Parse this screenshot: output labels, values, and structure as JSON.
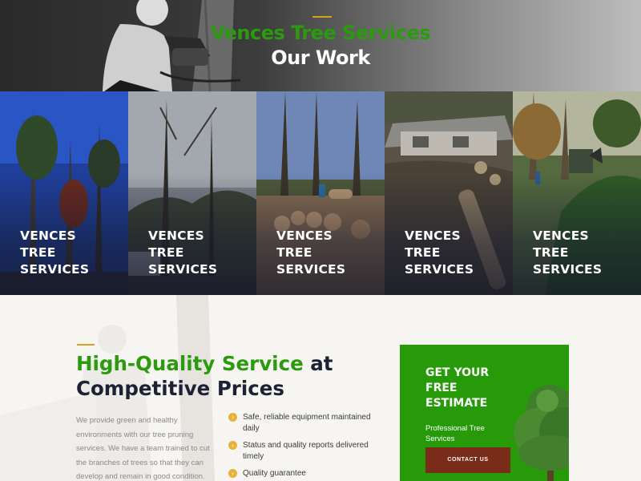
{
  "hero": {
    "brand": "Vences Tree Services",
    "title": "Our Work"
  },
  "gallery": {
    "tiles": [
      {
        "caption_lines": [
          "VENCES",
          "TREE",
          "SERVICES"
        ]
      },
      {
        "caption_lines": [
          "VENCES",
          "TREE",
          "SERVICES"
        ]
      },
      {
        "caption_lines": [
          "VENCES",
          "TREE",
          "SERVICES"
        ]
      },
      {
        "caption_lines": [
          "VENCES",
          "TREE",
          "SERVICES"
        ]
      },
      {
        "caption_lines": [
          "VENCES",
          "TREE",
          "SERVICES"
        ]
      }
    ]
  },
  "quality": {
    "headline_green": "High-Quality Service",
    "headline_rest_1": " at",
    "headline_rest_2": "Competitive Prices",
    "description": "We provide green and healthy environments with our tree pruning services. We have a team trained to cut the branches of trees so that they can develop and remain in good condition.",
    "features": [
      "Safe, reliable equipment maintained daily",
      "Status and quality reports delivered timely",
      "Quality guarantee"
    ]
  },
  "estimate": {
    "title": "GET YOUR FREE ESTIMATE",
    "subtitle": "Professional Tree Services",
    "cta_label": "CONTACT US"
  },
  "colors": {
    "brand_green": "#2c9a0f",
    "accent_gold": "#d8a31a",
    "cta_brown": "#7a2c1b",
    "navy": "#1c2233"
  },
  "icons": [
    "arrow-right-circle-icon"
  ]
}
